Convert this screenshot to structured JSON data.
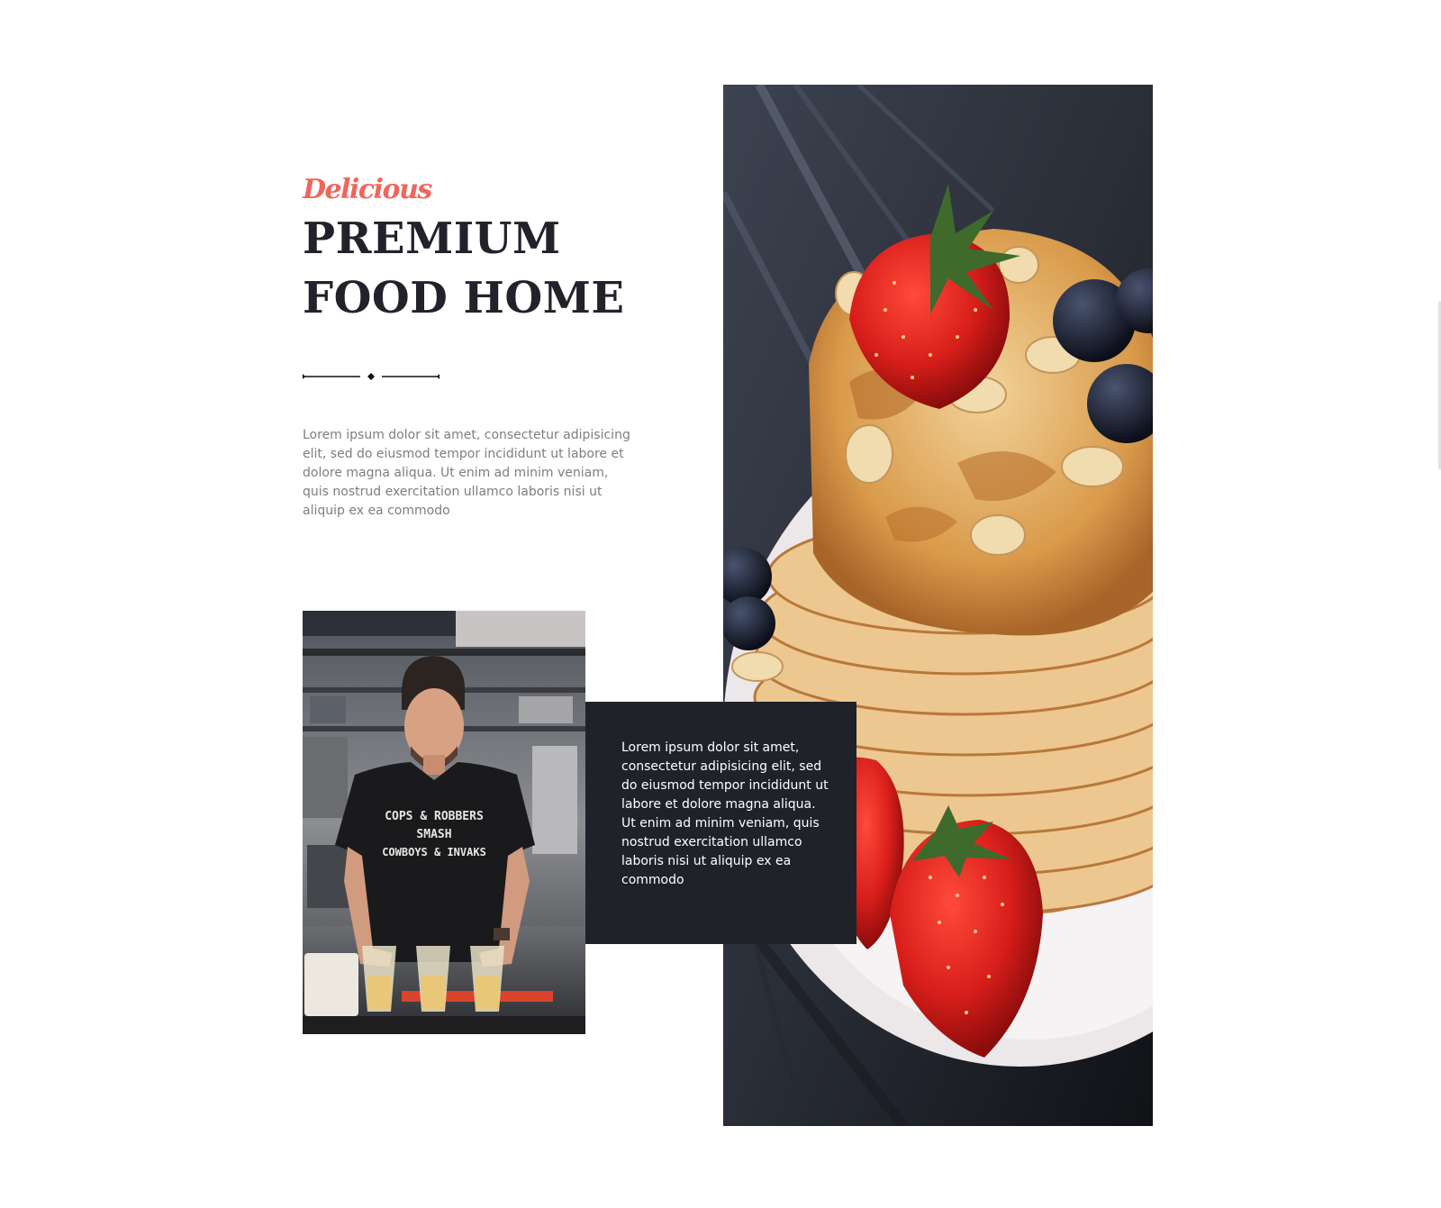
{
  "hero": {
    "script_title": "Delicious",
    "headline_line1": "PREMIUM",
    "headline_line2": "FOOD HOME",
    "intro_text": "Lorem ipsum dolor sit amet, consectetur adipisicing elit, sed do eiusmod tempor incididunt ut labore et dolore magna aliqua. Ut enim ad minim veniam, quis nostrud exercitation ullamco laboris nisi ut aliquip ex ea commodo"
  },
  "card": {
    "text": "Lorem ipsum dolor sit amet, consectetur adipisicing elit, sed do eiusmod tempor incididunt ut labore et dolore magna aliqua. Ut enim ad minim veniam, quis nostrud exercitation ullamco laboris nisi ut aliquip ex ea commodo"
  },
  "chef_photo": {
    "shirt_line1": "COPS & ROBBERS",
    "shirt_line2": "SMASH",
    "shirt_line3": "COWBOYS & INVAKS"
  },
  "colors": {
    "accent": "#f0655c",
    "heading": "#22222b",
    "body_text": "#7d7d85",
    "card_background": "#20222a"
  },
  "icons": {
    "divider": "line-diamond-divider-icon"
  }
}
